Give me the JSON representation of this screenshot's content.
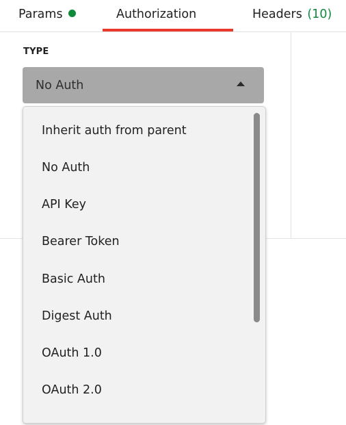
{
  "tabs": [
    {
      "label": "Params",
      "indicator_color": "#0f8a3a"
    },
    {
      "label": "Authorization",
      "active": true
    },
    {
      "label": "Headers",
      "count": "(10)",
      "count_color": "#0f8a3a"
    }
  ],
  "accent_color": "#e8392c",
  "auth": {
    "type_label": "TYPE",
    "selected": "No Auth",
    "dropdown_open": true,
    "options": [
      "Inherit auth from parent",
      "No Auth",
      "API Key",
      "Bearer Token",
      "Basic Auth",
      "Digest Auth",
      "OAuth 1.0",
      "OAuth 2.0"
    ]
  }
}
